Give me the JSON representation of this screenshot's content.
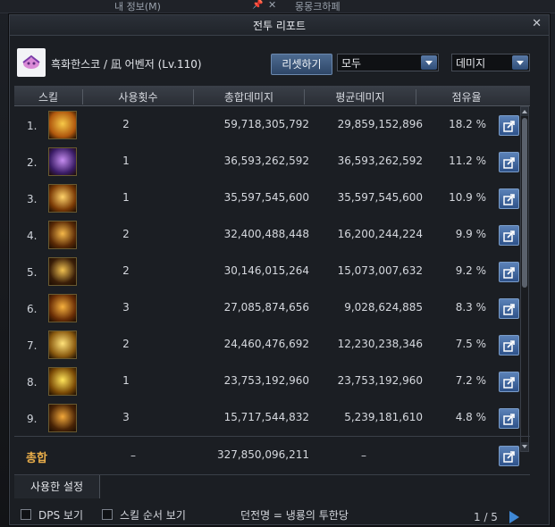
{
  "background": {
    "top_left_text": "내 정보(M)",
    "top_right_text": "몽몽크하페"
  },
  "window": {
    "title": "전투 리포트",
    "close_label": "✕"
  },
  "header": {
    "character": "흑화한스코 / 凪 어벤저 (Lv.110)",
    "reset_label": "리셋하기",
    "filter_value": "모두",
    "type_value": "데미지"
  },
  "table": {
    "columns": [
      "스킬",
      "사용횟수",
      "총합데미지",
      "평균데미지",
      "점유율"
    ],
    "rows": [
      {
        "rank": "1.",
        "uses": "2",
        "total": "59,718,305,792",
        "avg": "29,859,152,896",
        "share": "18.2 %",
        "icon": "skill-icon-burst"
      },
      {
        "rank": "2.",
        "uses": "1",
        "total": "36,593,262,592",
        "avg": "36,593,262,592",
        "share": "11.2 %",
        "icon": "skill-icon-rift"
      },
      {
        "rank": "3.",
        "uses": "1",
        "total": "35,597,545,600",
        "avg": "35,597,545,600",
        "share": "10.9 %",
        "icon": "skill-icon-star"
      },
      {
        "rank": "4.",
        "uses": "2",
        "total": "32,400,488,448",
        "avg": "16,200,244,224",
        "share": "9.9 %",
        "icon": "skill-icon-claw"
      },
      {
        "rank": "5.",
        "uses": "2",
        "total": "30,146,015,264",
        "avg": "15,073,007,632",
        "share": "9.2 %",
        "icon": "skill-icon-skull"
      },
      {
        "rank": "6.",
        "uses": "3",
        "total": "27,085,874,656",
        "avg": "9,028,624,885",
        "share": "8.3 %",
        "icon": "skill-icon-swirl"
      },
      {
        "rank": "7.",
        "uses": "2",
        "total": "24,460,476,692",
        "avg": "12,230,238,346",
        "share": "7.5 %",
        "icon": "skill-icon-beam"
      },
      {
        "rank": "8.",
        "uses": "1",
        "total": "23,753,192,960",
        "avg": "23,753,192,960",
        "share": "7.2 %",
        "icon": "skill-icon-flash"
      },
      {
        "rank": "9.",
        "uses": "3",
        "total": "15,717,544,832",
        "avg": "5,239,181,610",
        "share": "4.8 %",
        "icon": "skill-icon-vortex"
      }
    ]
  },
  "total": {
    "label": "총합",
    "uses": "–",
    "total": "327,850,096,211",
    "avg": "–"
  },
  "tabs": {
    "active": "사용한 설정"
  },
  "footer": {
    "dps_label": "DPS 보기",
    "order_label": "스킬 순서 보기",
    "note": "던전명 = 냉룡의 투한당",
    "page": "1 / 5"
  },
  "colors": {
    "accent_blue": "#3f88d6",
    "total_label": "#e8ad4a",
    "panel_bg": "#1b1e23"
  }
}
